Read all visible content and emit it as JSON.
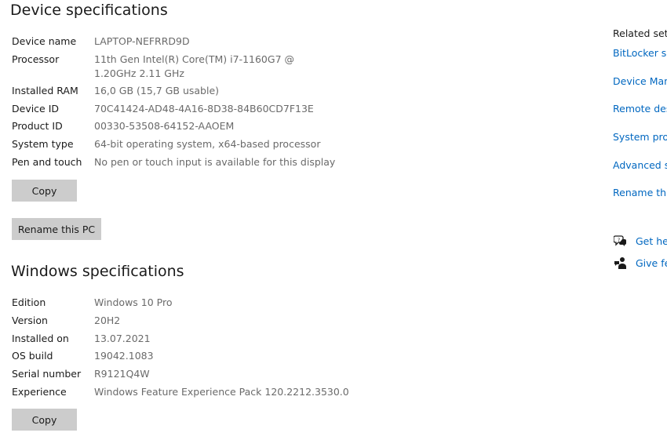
{
  "device_specs": {
    "title": "Device specifications",
    "rows": [
      {
        "label": "Device name",
        "value": "LAPTOP-NEFRRD9D"
      },
      {
        "label": "Processor",
        "value": "11th Gen Intel(R) Core(TM) i7-1160G7 @ 1.20GHz   2.11 GHz"
      },
      {
        "label": "Installed RAM",
        "value": "16,0 GB (15,7 GB usable)"
      },
      {
        "label": "Device ID",
        "value": "70C41424-AD48-4A16-8D38-84B60CD7F13E"
      },
      {
        "label": "Product ID",
        "value": "00330-53508-64152-AAOEM"
      },
      {
        "label": "System type",
        "value": "64-bit operating system, x64-based processor"
      },
      {
        "label": "Pen and touch",
        "value": "No pen or touch input is available for this display"
      }
    ],
    "copy_label": "Copy",
    "rename_label": "Rename this PC"
  },
  "windows_specs": {
    "title": "Windows specifications",
    "rows": [
      {
        "label": "Edition",
        "value": "Windows 10 Pro"
      },
      {
        "label": "Version",
        "value": "20H2"
      },
      {
        "label": "Installed on",
        "value": "13.07.2021"
      },
      {
        "label": "OS build",
        "value": "19042.1083"
      },
      {
        "label": "Serial number",
        "value": "R9121Q4W"
      },
      {
        "label": "Experience",
        "value": "Windows Feature Experience Pack 120.2212.3530.0"
      }
    ],
    "copy_label": "Copy"
  },
  "related": {
    "title": "Related setti",
    "links": [
      "BitLocker se",
      "Device Mana",
      "Remote desk",
      "System prote",
      "Advanced sy",
      "Rename this"
    ]
  },
  "help": {
    "get_help": "Get hel",
    "give_feedback": "Give fe",
    "icons": [
      "get-help-icon",
      "give-feedback-icon"
    ]
  },
  "colors": {
    "link": "#0067c0",
    "button_bg": "#cccccc",
    "value_text": "#6a6a6a"
  }
}
